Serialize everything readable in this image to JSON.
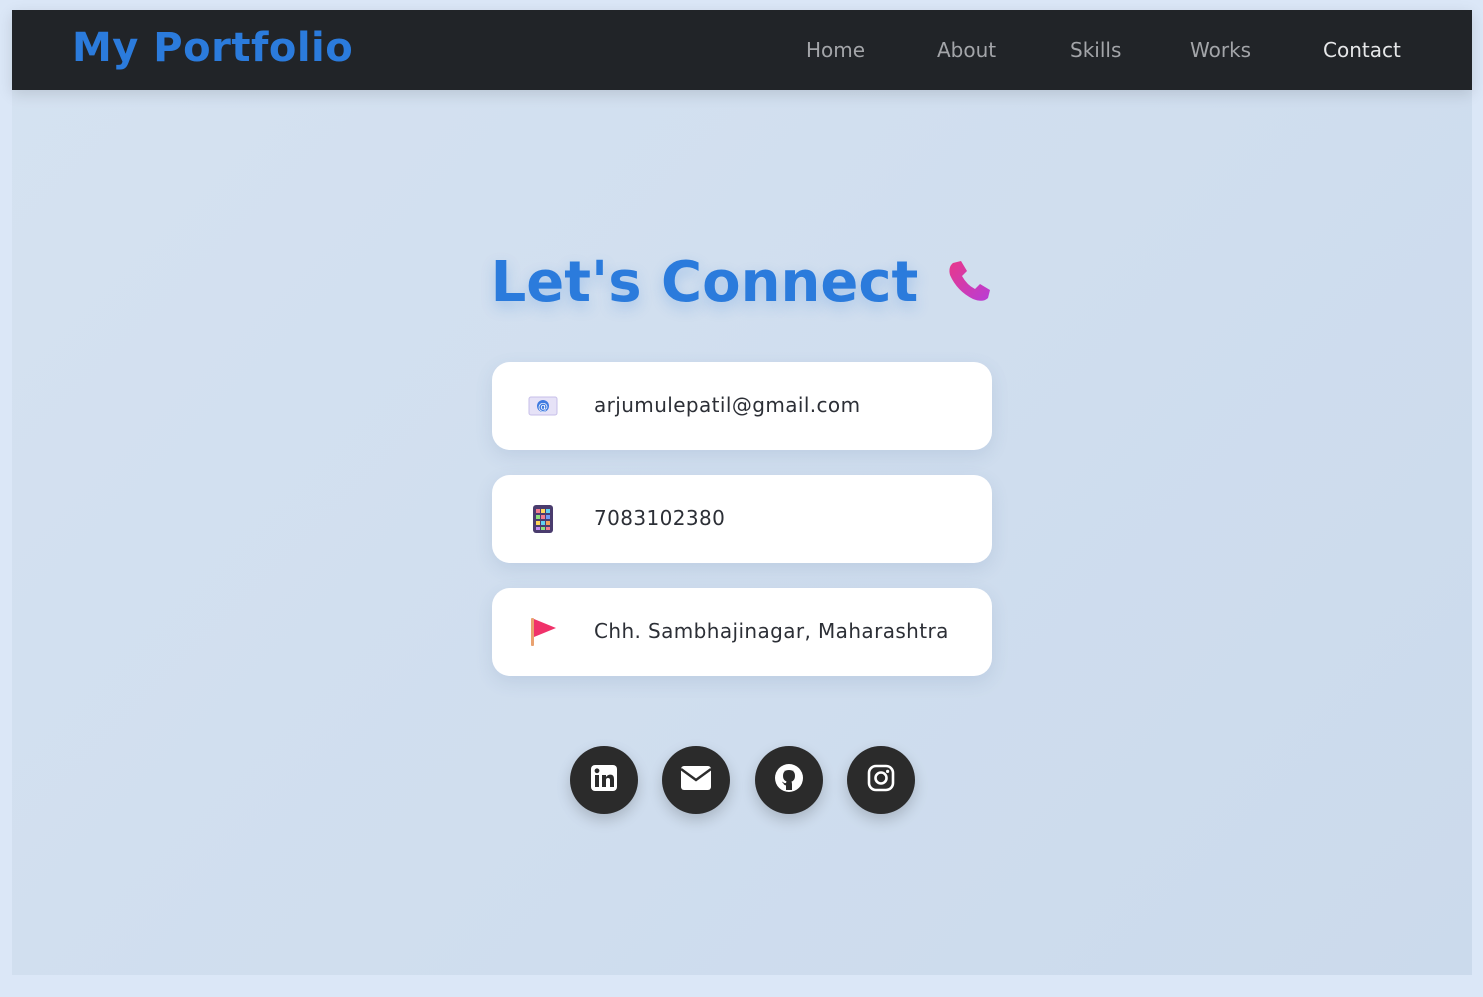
{
  "navbar": {
    "brand": "My Portfolio",
    "links": [
      {
        "label": "Home",
        "active": false
      },
      {
        "label": "About",
        "active": false
      },
      {
        "label": "Skills",
        "active": false
      },
      {
        "label": "Works",
        "active": false
      },
      {
        "label": "Contact",
        "active": true
      }
    ]
  },
  "contact": {
    "heading": "Let's Connect",
    "heading_icon": "telephone-receiver-icon",
    "items": [
      {
        "icon": "email-icon",
        "text": "arjumulepatil@gmail.com"
      },
      {
        "icon": "mobile-phone-icon",
        "text": "7083102380"
      },
      {
        "icon": "red-flag-icon",
        "text": "Chh. Sambhajinagar, Maharashtra"
      }
    ]
  },
  "social": [
    {
      "icon": "linkedin-icon"
    },
    {
      "icon": "envelope-icon"
    },
    {
      "icon": "github-icon"
    },
    {
      "icon": "instagram-icon"
    }
  ],
  "colors": {
    "accent": "#2b7bdc",
    "navbar_bg": "#212428",
    "page_bg": "#cfdcee",
    "social_bg": "#2b2b2b"
  }
}
